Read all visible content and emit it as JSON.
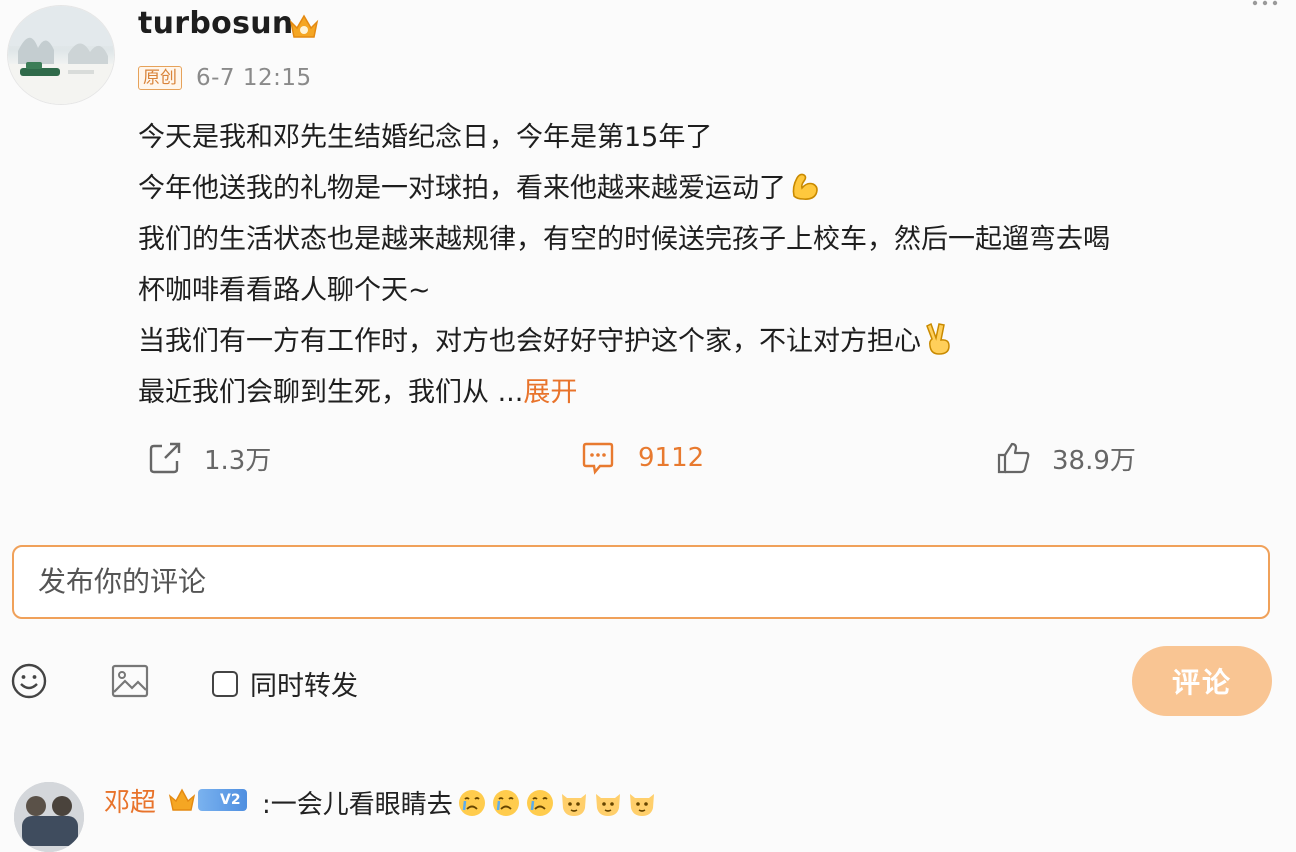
{
  "post": {
    "username": "turbosun",
    "original_badge": "原创",
    "time": "6-7 12:15",
    "lines": [
      "今天是我和邓先生结婚纪念日，今年是第15年了",
      "今年他送我的礼物是一对球拍，看来他越来越爱运动了",
      "我们的生活状态也是越来越规律，有空的时候送完孩子上校车，然后一起遛弯去喝",
      "杯咖啡看看路人聊个天~",
      "当我们有一方有工作时，对方也会好好守护这个家，不让对方担心",
      "最近我们会聊到生死，我们从 ..."
    ],
    "expand_label": "展开"
  },
  "actions": {
    "repost_count": "1.3万",
    "comment_count": "9112",
    "like_count": "38.9万"
  },
  "composer": {
    "placeholder": "发布你的评论",
    "repost_label": "同时转发",
    "submit_label": "评论"
  },
  "reply": {
    "name": "邓超",
    "badge": "V2",
    "text": ":一会儿看眼睛去"
  },
  "colors": {
    "accent": "#e8732b",
    "submit_bg": "#f9c593",
    "border": "#f0a15a"
  }
}
